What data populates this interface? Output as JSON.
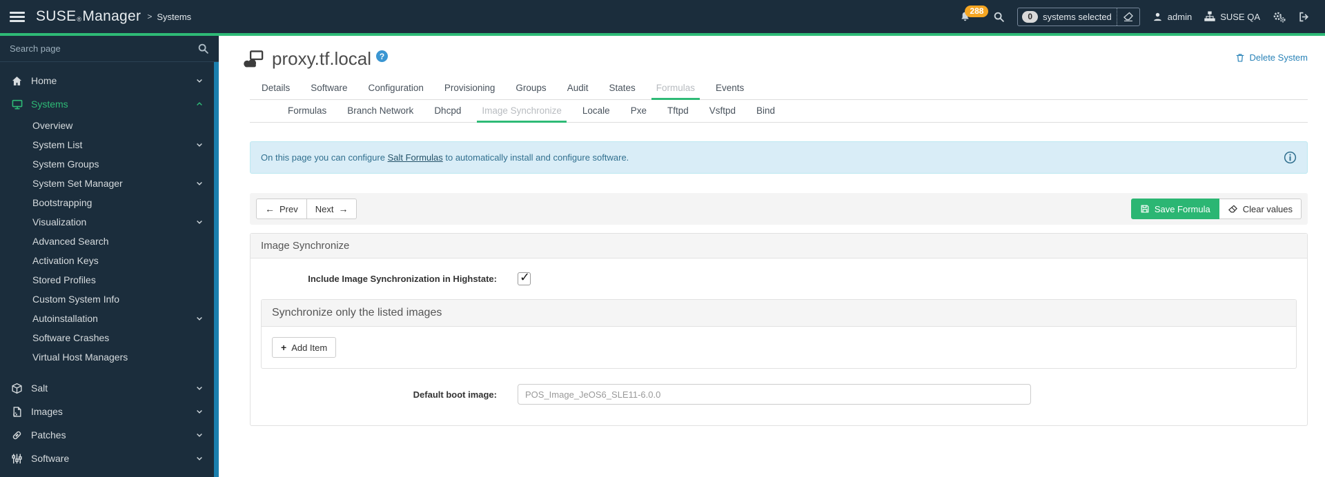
{
  "navbar": {
    "brand": {
      "suse": "SUSE",
      "reg": "®",
      "manager": "Manager"
    },
    "breadcrumb_sep": ">",
    "breadcrumb": "Systems",
    "notification_count": "288",
    "selection": {
      "count": "0",
      "label": "systems selected"
    },
    "user": "admin",
    "organization": "SUSE QA"
  },
  "sidebar": {
    "search_placeholder": "Search page",
    "items": [
      {
        "label": "Home"
      },
      {
        "label": "Systems"
      },
      {
        "label": "Overview"
      },
      {
        "label": "System List"
      },
      {
        "label": "System Groups"
      },
      {
        "label": "System Set Manager"
      },
      {
        "label": "Bootstrapping"
      },
      {
        "label": "Visualization"
      },
      {
        "label": "Advanced Search"
      },
      {
        "label": "Activation Keys"
      },
      {
        "label": "Stored Profiles"
      },
      {
        "label": "Custom System Info"
      },
      {
        "label": "Autoinstallation"
      },
      {
        "label": "Software Crashes"
      },
      {
        "label": "Virtual Host Managers"
      },
      {
        "label": "Salt"
      },
      {
        "label": "Images"
      },
      {
        "label": "Patches"
      },
      {
        "label": "Software"
      }
    ]
  },
  "header": {
    "title": "proxy.tf.local",
    "help_glyph": "?",
    "delete_label": "Delete System"
  },
  "tabs": {
    "primary": [
      "Details",
      "Software",
      "Configuration",
      "Provisioning",
      "Groups",
      "Audit",
      "States",
      "Formulas",
      "Events"
    ],
    "primary_active": "Formulas",
    "secondary": [
      "Formulas",
      "Branch Network",
      "Dhcpd",
      "Image Synchronize",
      "Locale",
      "Pxe",
      "Tftpd",
      "Vsftpd",
      "Bind"
    ],
    "secondary_active": "Image Synchronize"
  },
  "alert": {
    "text_before": "On this page you can configure ",
    "link_text": "Salt Formulas",
    "text_after": " to automatically install and configure software."
  },
  "toolbar": {
    "prev_label": "Prev",
    "next_label": "Next",
    "prev_arrow": "←",
    "next_arrow": "→",
    "save_label": "Save Formula",
    "clear_label": "Clear values"
  },
  "form": {
    "panel_title": "Image Synchronize",
    "highstate_label": "Include Image Synchronization in Highstate:",
    "checkbox_checked": true,
    "checkbox_glyph": "✓",
    "inner_panel_title": "Synchronize only the listed images",
    "add_item_label": "Add Item",
    "add_item_plus": "+",
    "boot_image_label": "Default boot image:",
    "boot_image_value": "POS_Image_JeOS6_SLE11-6.0.0"
  },
  "colors": {
    "navbar_bg": "#1b2d3c",
    "accent_green": "#2eba76",
    "save_button_green": "#2bb673",
    "notification_badge_orange": "#f5a623",
    "sidebar_scrollbar_blue": "#1a7fae",
    "alert_bg": "#d9edf7",
    "alert_text": "#31708f",
    "link_blue": "#2a83b8"
  }
}
